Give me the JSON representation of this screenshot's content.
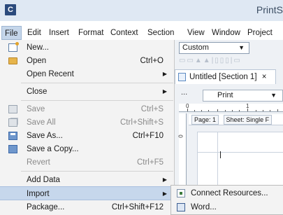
{
  "app": {
    "icon_letter": "C",
    "title": "PrintS"
  },
  "menubar": [
    "File",
    "Edit",
    "Insert",
    "Format",
    "Context",
    "Section",
    "View",
    "Window",
    "Project"
  ],
  "toolbar": {
    "style_dropdown": "Custom",
    "doc_tab": "Untitled [Section 1]",
    "tab_close": "×",
    "ellipsis": "...",
    "view_dropdown": "Print",
    "ruler_h": [
      "0",
      "1"
    ],
    "ruler_v": "0",
    "page_label": "Page: 1",
    "sheet_label": "Sheet: Single F"
  },
  "file_menu": [
    {
      "label": "New...",
      "icon": "new-file-icon"
    },
    {
      "label": "Open",
      "shortcut": "Ctrl+O",
      "icon": "open-folder-icon"
    },
    {
      "label": "Open Recent",
      "submenu": true
    },
    {
      "separator": true
    },
    {
      "label": "Close",
      "submenu": true
    },
    {
      "separator": true
    },
    {
      "label": "Save",
      "shortcut": "Ctrl+S",
      "disabled": true,
      "icon": "save-icon"
    },
    {
      "label": "Save All",
      "shortcut": "Ctrl+Shift+S",
      "disabled": true,
      "icon": "save-all-icon"
    },
    {
      "label": "Save As...",
      "shortcut": "Ctrl+F10",
      "icon": "save-as-icon"
    },
    {
      "label": "Save a Copy...",
      "icon": "save-copy-icon"
    },
    {
      "label": "Revert",
      "shortcut": "Ctrl+F5",
      "disabled": true
    },
    {
      "separator": true
    },
    {
      "label": "Add Data",
      "submenu": true
    },
    {
      "label": "Import",
      "submenu": true,
      "highlighted": true
    },
    {
      "label": "Package...",
      "shortcut": "Ctrl+Shift+F12"
    }
  ],
  "import_submenu": [
    {
      "label": "Connect Resources...",
      "icon": "connect-resources-icon"
    },
    {
      "label": "Word...",
      "icon": "word-document-icon"
    }
  ],
  "colors": {
    "titlebar": "#dfe8f3",
    "menu_background": "#f3f3f3",
    "highlight": "#c6d7ec",
    "disabled_text": "#8a8a8a"
  }
}
